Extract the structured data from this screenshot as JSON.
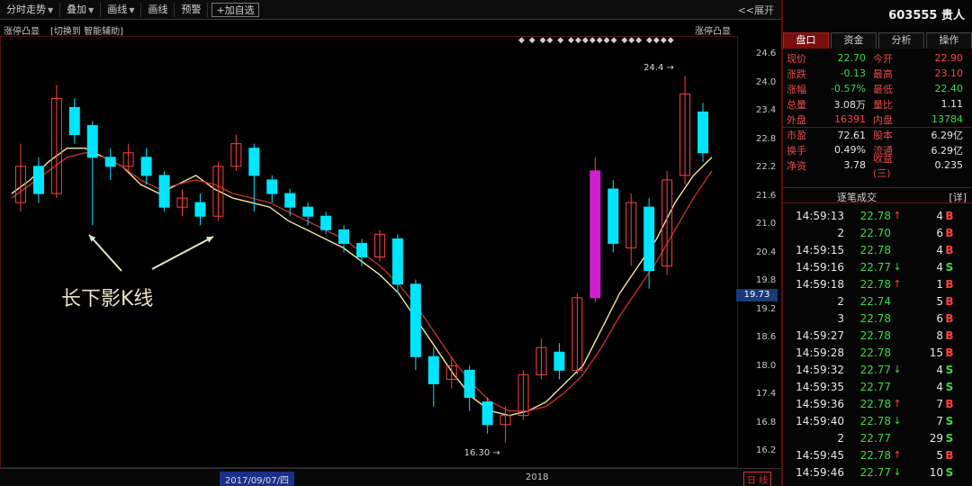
{
  "toolbar": {
    "items": [
      {
        "label": "分时走势",
        "dropdown": true
      },
      {
        "label": "叠加",
        "dropdown": true
      },
      {
        "label": "画线",
        "dropdown": true
      },
      {
        "label": "画线",
        "dropdown": false
      },
      {
        "label": "预警",
        "dropdown": false
      }
    ],
    "add_label": "+加自选",
    "expand_label": "<<展开"
  },
  "chart_header": {
    "indicator_name": "涨停凸显",
    "switch_label": "[切换到 智能辅助]",
    "indicator_name_right": "涨停凸显",
    "tag_row": "◆ ◆ ◆◆ ◆ ◆◆◆◆◆◆◆ ◆◆◆ ◆◆◆◆"
  },
  "annotation": {
    "text": "长下影K线",
    "color": "#e8e3c8"
  },
  "price_axis": {
    "ticks": [
      "24.6",
      "24.0",
      "23.4",
      "22.8",
      "22.2",
      "21.6",
      "21.0",
      "20.4",
      "19.8",
      "19.2",
      "18.6",
      "18.0",
      "17.4",
      "16.8",
      "16.2"
    ],
    "current_price": "19.73"
  },
  "date_bar": {
    "highlight": "2017/09/07/四",
    "year": "2018",
    "right_label": "日 线"
  },
  "chart_labels": {
    "high": "24.4",
    "low": "16.30"
  },
  "colors": {
    "up": "#ff4040",
    "down": "#00e5ff",
    "ma_short": "#f5e6a0",
    "ma_long": "#c0302a",
    "limit_up": "#d020d0"
  },
  "chart_data": {
    "type": "candlestick",
    "ylim": [
      16.0,
      24.9
    ],
    "moving_averages": [
      {
        "name": "",
        "color": "#f5e6a0",
        "values": [
          21.8,
          22.1,
          22.5,
          22.8,
          22.8,
          22.6,
          22.4,
          22.0,
          21.8,
          22.0,
          22.2,
          21.9,
          21.7,
          21.6,
          21.5,
          21.2,
          21.0,
          20.8,
          20.6,
          20.3,
          20.0,
          19.6,
          19.0,
          18.4,
          17.8,
          17.3,
          17.0,
          16.9,
          17.0,
          17.2,
          17.6,
          18.0,
          18.8,
          19.6,
          20.2,
          20.8,
          21.6,
          22.2,
          22.6
        ]
      },
      {
        "name": "",
        "color": "#c0302a",
        "values": [
          21.7,
          22.0,
          22.3,
          22.6,
          22.7,
          22.6,
          22.4,
          22.1,
          21.9,
          22.0,
          22.1,
          22.0,
          21.8,
          21.7,
          21.6,
          21.4,
          21.2,
          21.0,
          20.8,
          20.5,
          20.2,
          19.8,
          19.3,
          18.7,
          18.1,
          17.6,
          17.2,
          17.0,
          17.0,
          17.1,
          17.4,
          17.8,
          18.4,
          19.1,
          19.7,
          20.3,
          21.0,
          21.7,
          22.3
        ]
      }
    ],
    "candles": [
      {
        "o": 21.6,
        "c": 22.4,
        "h": 22.9,
        "l": 21.4
      },
      {
        "o": 22.4,
        "c": 21.8,
        "h": 22.6,
        "l": 21.6
      },
      {
        "o": 21.8,
        "c": 23.9,
        "h": 24.2,
        "l": 21.7
      },
      {
        "o": 23.7,
        "c": 23.1,
        "h": 23.9,
        "l": 22.9
      },
      {
        "o": 23.3,
        "c": 22.6,
        "h": 23.4,
        "l": 21.1
      },
      {
        "o": 22.6,
        "c": 22.4,
        "h": 22.8,
        "l": 22.1
      },
      {
        "o": 22.4,
        "c": 22.7,
        "h": 22.9,
        "l": 22.3
      },
      {
        "o": 22.6,
        "c": 22.2,
        "h": 22.8,
        "l": 22.0
      },
      {
        "o": 22.2,
        "c": 21.5,
        "h": 22.3,
        "l": 21.4
      },
      {
        "o": 21.5,
        "c": 21.7,
        "h": 21.9,
        "l": 21.3
      },
      {
        "o": 21.6,
        "c": 21.3,
        "h": 21.8,
        "l": 21.1
      },
      {
        "o": 21.3,
        "c": 22.4,
        "h": 22.5,
        "l": 21.2
      },
      {
        "o": 22.4,
        "c": 22.9,
        "h": 23.1,
        "l": 22.3
      },
      {
        "o": 22.8,
        "c": 22.2,
        "h": 22.9,
        "l": 21.4
      },
      {
        "o": 22.1,
        "c": 21.8,
        "h": 22.2,
        "l": 21.6
      },
      {
        "o": 21.8,
        "c": 21.5,
        "h": 21.9,
        "l": 21.3
      },
      {
        "o": 21.5,
        "c": 21.3,
        "h": 21.6,
        "l": 21.1
      },
      {
        "o": 21.3,
        "c": 21.0,
        "h": 21.4,
        "l": 20.9
      },
      {
        "o": 21.0,
        "c": 20.7,
        "h": 21.1,
        "l": 20.5
      },
      {
        "o": 20.7,
        "c": 20.4,
        "h": 20.8,
        "l": 20.2
      },
      {
        "o": 20.4,
        "c": 20.9,
        "h": 21.0,
        "l": 20.3
      },
      {
        "o": 20.8,
        "c": 19.8,
        "h": 20.9,
        "l": 19.6
      },
      {
        "o": 19.8,
        "c": 18.2,
        "h": 19.9,
        "l": 17.9
      },
      {
        "o": 18.2,
        "c": 17.6,
        "h": 18.4,
        "l": 17.1
      },
      {
        "o": 17.7,
        "c": 18.0,
        "h": 18.2,
        "l": 17.5
      },
      {
        "o": 17.9,
        "c": 17.3,
        "h": 18.0,
        "l": 17.0
      },
      {
        "o": 17.2,
        "c": 16.7,
        "h": 17.3,
        "l": 16.5
      },
      {
        "o": 16.7,
        "c": 16.9,
        "h": 17.1,
        "l": 16.3
      },
      {
        "o": 16.9,
        "c": 17.8,
        "h": 17.9,
        "l": 16.8
      },
      {
        "o": 17.8,
        "c": 18.4,
        "h": 18.6,
        "l": 17.7
      },
      {
        "o": 18.3,
        "c": 17.9,
        "h": 18.5,
        "l": 17.7
      },
      {
        "o": 17.9,
        "c": 19.5,
        "h": 19.6,
        "l": 17.8
      },
      {
        "o": 19.5,
        "c": 22.3,
        "h": 22.6,
        "l": 19.4
      },
      {
        "o": 21.9,
        "c": 20.7,
        "h": 22.1,
        "l": 20.5
      },
      {
        "o": 20.6,
        "c": 21.6,
        "h": 21.8,
        "l": 20.2
      },
      {
        "o": 21.5,
        "c": 20.1,
        "h": 21.7,
        "l": 19.7
      },
      {
        "o": 20.2,
        "c": 22.1,
        "h": 22.3,
        "l": 20.0
      },
      {
        "o": 22.2,
        "c": 24.0,
        "h": 24.4,
        "l": 22.0
      },
      {
        "o": 23.6,
        "c": 22.7,
        "h": 23.8,
        "l": 22.5
      }
    ],
    "high_label": {
      "value": 24.4,
      "index": 37
    },
    "low_label": {
      "value": 16.3,
      "index": 27
    }
  },
  "right_panel": {
    "stock_code": "603555 贵人",
    "tabs": [
      "盘口",
      "资金",
      "分析",
      "操作"
    ],
    "active_tab": 0,
    "quote": [
      [
        {
          "label": "现价",
          "value": "22.70",
          "cls": "down"
        },
        {
          "label": "今开",
          "value": "22.90",
          "cls": "up"
        }
      ],
      [
        {
          "label": "涨跌",
          "value": "-0.13",
          "cls": "down"
        },
        {
          "label": "最高",
          "value": "23.10",
          "cls": "up"
        }
      ],
      [
        {
          "label": "涨幅",
          "value": "-0.57%",
          "cls": "down"
        },
        {
          "label": "最低",
          "value": "22.40",
          "cls": "down"
        }
      ],
      [
        {
          "label": "总量",
          "value": "3.08万",
          "cls": "white"
        },
        {
          "label": "量比",
          "value": "1.11",
          "cls": "white"
        }
      ],
      [
        {
          "label": "外盘",
          "value": "16391",
          "cls": "up"
        },
        {
          "label": "内盘",
          "value": "13784",
          "cls": "down"
        }
      ],
      [
        {
          "label": "市盈",
          "value": "72.61",
          "cls": "white"
        },
        {
          "label": "股本",
          "value": "6.29亿",
          "cls": "white"
        }
      ],
      [
        {
          "label": "换手",
          "value": "0.49%",
          "cls": "white"
        },
        {
          "label": "流通",
          "value": "6.29亿",
          "cls": "white"
        }
      ],
      [
        {
          "label": "净资",
          "value": "3.78",
          "cls": "white"
        },
        {
          "label": "收益(三)",
          "value": "0.235",
          "cls": "white"
        }
      ]
    ],
    "trades_title": "逐笔成交",
    "trades_more": "[详]",
    "trades": [
      {
        "time": "14:59:13",
        "price": "22.78",
        "arrow": "↑",
        "arrow_cls": "up",
        "vol": "4",
        "side": "B",
        "side_cls": "up"
      },
      {
        "time": "2",
        "price": "22.70",
        "arrow": "",
        "arrow_cls": "",
        "vol": "6",
        "side": "B",
        "side_cls": "up"
      },
      {
        "time": "14:59:15",
        "price": "22.78",
        "arrow": "",
        "arrow_cls": "",
        "vol": "4",
        "side": "B",
        "side_cls": "up"
      },
      {
        "time": "14:59:16",
        "price": "22.77",
        "arrow": "↓",
        "arrow_cls": "down",
        "vol": "4",
        "side": "S",
        "side_cls": "down"
      },
      {
        "time": "14:59:18",
        "price": "22.78",
        "arrow": "↑",
        "arrow_cls": "up",
        "vol": "1",
        "side": "B",
        "side_cls": "up"
      },
      {
        "time": "2",
        "price": "22.74",
        "arrow": "",
        "arrow_cls": "",
        "vol": "5",
        "side": "B",
        "side_cls": "up"
      },
      {
        "time": "3",
        "price": "22.78",
        "arrow": "",
        "arrow_cls": "",
        "vol": "6",
        "side": "B",
        "side_cls": "up"
      },
      {
        "time": "14:59:27",
        "price": "22.78",
        "arrow": "",
        "arrow_cls": "",
        "vol": "8",
        "side": "B",
        "side_cls": "up"
      },
      {
        "time": "14:59:28",
        "price": "22.78",
        "arrow": "",
        "arrow_cls": "",
        "vol": "15",
        "side": "B",
        "side_cls": "up"
      },
      {
        "time": "14:59:32",
        "price": "22.77",
        "arrow": "↓",
        "arrow_cls": "down",
        "vol": "4",
        "side": "S",
        "side_cls": "down"
      },
      {
        "time": "14:59:35",
        "price": "22.77",
        "arrow": "",
        "arrow_cls": "",
        "vol": "4",
        "side": "S",
        "side_cls": "down"
      },
      {
        "time": "14:59:36",
        "price": "22.78",
        "arrow": "↑",
        "arrow_cls": "up",
        "vol": "7",
        "side": "B",
        "side_cls": "up"
      },
      {
        "time": "14:59:40",
        "price": "22.78",
        "arrow": "↓",
        "arrow_cls": "down",
        "vol": "7",
        "side": "S",
        "side_cls": "down"
      },
      {
        "time": "2",
        "price": "22.77",
        "arrow": "",
        "arrow_cls": "",
        "vol": "29",
        "side": "S",
        "side_cls": "down"
      },
      {
        "time": "14:59:45",
        "price": "22.78",
        "arrow": "↑",
        "arrow_cls": "up",
        "vol": "5",
        "side": "B",
        "side_cls": "up"
      },
      {
        "time": "14:59:46",
        "price": "22.77",
        "arrow": "↓",
        "arrow_cls": "down",
        "vol": "10",
        "side": "S",
        "side_cls": "down"
      }
    ]
  }
}
